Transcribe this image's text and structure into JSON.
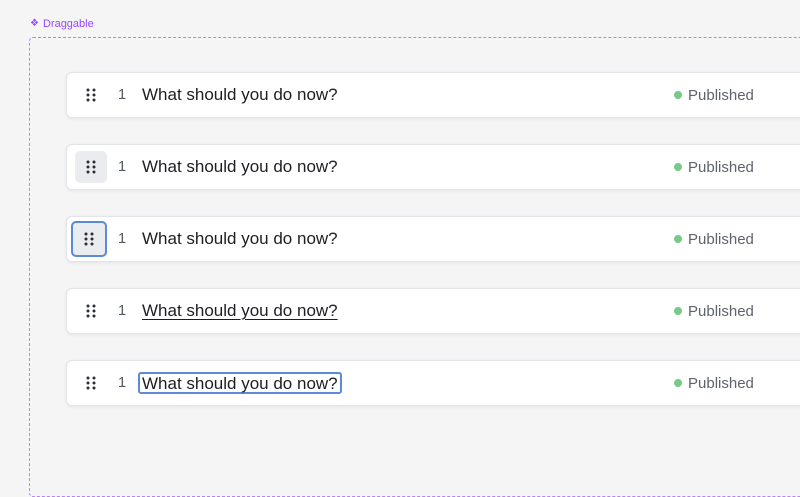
{
  "frame": {
    "label": "Draggable",
    "icon": "component-icon",
    "accent": "#9747ff"
  },
  "rows": [
    {
      "state": "default",
      "index": "1",
      "title": "What should you do now?",
      "status": "Published",
      "status_color": "#79c98a"
    },
    {
      "state": "handle-hover",
      "index": "1",
      "title": "What should you do now?",
      "status": "Published",
      "status_color": "#79c98a"
    },
    {
      "state": "handle-focus",
      "index": "1",
      "title": "What should you do now?",
      "status": "Published",
      "status_color": "#79c98a"
    },
    {
      "state": "title-hover",
      "index": "1",
      "title": "What should you do now?",
      "status": "Published",
      "status_color": "#79c98a"
    },
    {
      "state": "title-focus",
      "index": "1",
      "title": "What should you do now?",
      "status": "Published",
      "status_color": "#79c98a"
    }
  ],
  "icons": {
    "handle": "drag-handle-icon",
    "status": "status-dot"
  }
}
